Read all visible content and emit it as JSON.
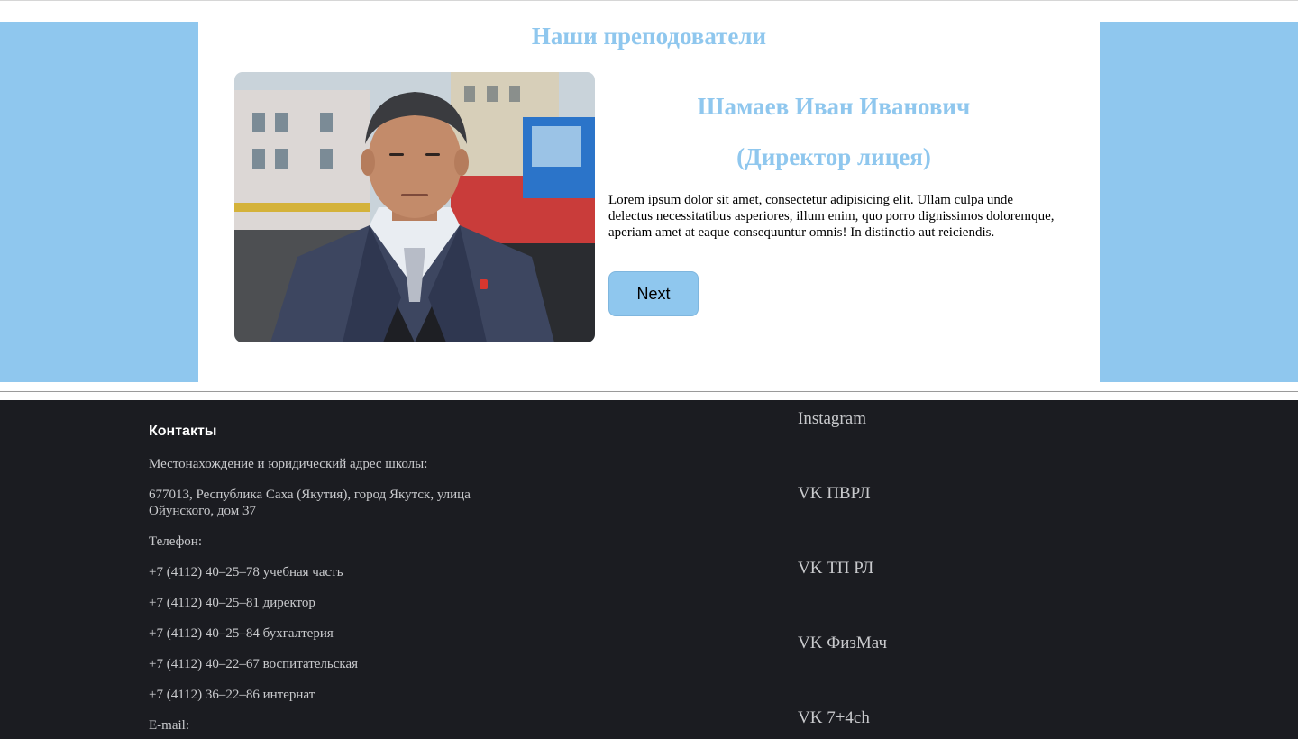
{
  "teachers_section": {
    "title": "Наши преподователи"
  },
  "teacher": {
    "name": "Шамаев Иван Иванович",
    "role": "(Директор лицея)",
    "description": "Lorem ipsum dolor sit amet, consectetur adipisicing elit. Ullam culpa unde delectus necessitatibus asperiores, illum enim, quo porro dignissimos doloremque, aperiam amet at eaque consequuntur omnis! In distinctio aut reiciendis.",
    "next_label": "Next"
  },
  "footer": {
    "contacts_heading": "Контакты",
    "lines": [
      "Местонахождение и юридический адрес школы:",
      "677013, Республика Саха (Якутия), город Якутск, улица Ойунского, дом 37",
      "Телефон:",
      "+7 (4112) 40–25–78 учебная часть",
      "+7 (4112) 40–25–81 директор",
      "+7 (4112) 40–25–84 бухгалтерия",
      "+7 (4112) 40–22–67 воспитательская",
      "+7 (4112) 36–22–86 интернат",
      "E-mail:"
    ],
    "social_links": [
      "Instagram",
      "VK ПВРЛ",
      "VK ТП РЛ",
      "VK ФизМач",
      "VK 7+4ch"
    ]
  },
  "colors": {
    "accent": "#8fc7ee",
    "footer_bg": "#1b1c21",
    "footer_text": "#c9cacd"
  }
}
